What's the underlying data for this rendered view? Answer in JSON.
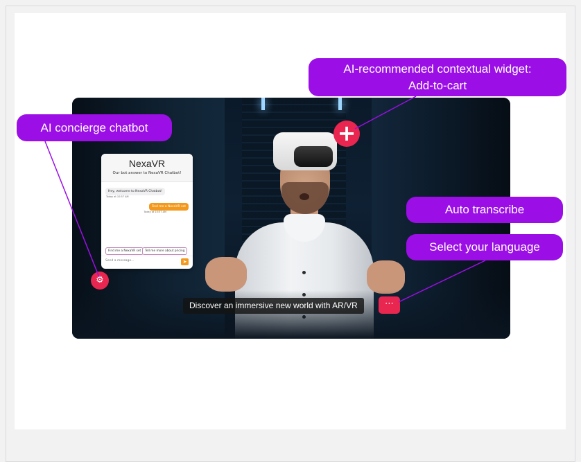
{
  "labels": {
    "add_to_cart_line1": "AI-recommended contextual widget:",
    "add_to_cart_line2": "Add-to-cart",
    "concierge": "AI concierge chatbot",
    "auto_transcribe": "Auto transcribe",
    "select_language": "Select your language"
  },
  "chat": {
    "title": "NexaVR",
    "subtitle": "Our bot answer to NexaVR Chatbot!",
    "incoming_message": "Hey, welcome to NexaVR Chatbot!",
    "incoming_time": "Today at 10:57 AM",
    "outgoing_message": "Find me a NexaVR set",
    "outgoing_time": "Today at 10:57 AM",
    "suggestions": [
      "Find me a NexaVR set",
      "Tell me more about pricing"
    ],
    "input_placeholder": "Send a message..."
  },
  "video": {
    "caption": "Discover an immersive new world with AR/VR"
  },
  "icons": {
    "plus": "plus-icon",
    "launcher": "chatbot-icon",
    "more": "ellipsis-icon",
    "send": "send-icon"
  },
  "colors": {
    "label_purple": "#9b0fe6",
    "accent_red": "#e8264f",
    "chat_orange": "#f39a1e"
  }
}
